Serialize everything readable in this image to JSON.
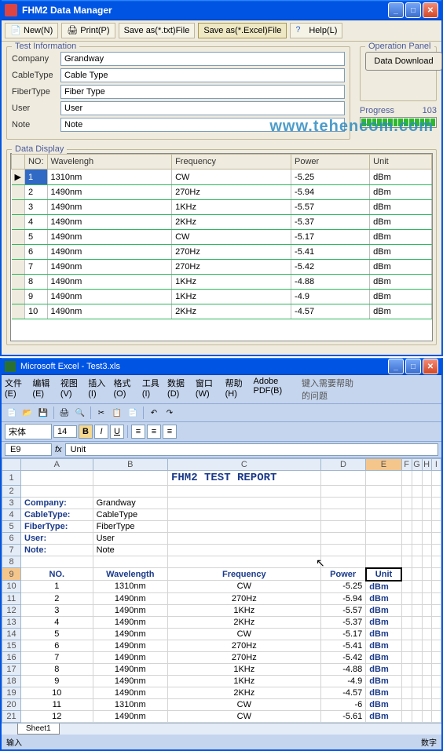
{
  "app1": {
    "title": "FHM2 Data Manager",
    "toolbar": [
      {
        "label": "New(N)"
      },
      {
        "label": "Print(P)"
      },
      {
        "label": "Save as(*.txt)File"
      },
      {
        "label": "Save as(*.Excel)File",
        "active": true
      },
      {
        "label": "Help(L)"
      }
    ],
    "test_info": {
      "title": "Test Information",
      "company_lbl": "Company",
      "company_val": "Grandway",
      "cabletype_lbl": "CableType",
      "cabletype_val": "Cable Type",
      "fibertype_lbl": "FiberType",
      "fibertype_val": "Fiber Type",
      "user_lbl": "User",
      "user_val": "User",
      "note_lbl": "Note",
      "note_val": "Note"
    },
    "op_panel": {
      "title": "Operation Panel",
      "download": "Data Download",
      "progress_lbl": "Progress",
      "progress_val": "103"
    },
    "data_display": {
      "title": "Data Display",
      "headers": [
        "",
        "NO:",
        "Wavelengh",
        "Frequency",
        "Power",
        "Unit"
      ],
      "rows": [
        [
          "1",
          "1310nm",
          "CW",
          "-5.25",
          "dBm"
        ],
        [
          "2",
          "1490nm",
          "270Hz",
          "-5.94",
          "dBm"
        ],
        [
          "3",
          "1490nm",
          "1KHz",
          "-5.57",
          "dBm"
        ],
        [
          "4",
          "1490nm",
          "2KHz",
          "-5.37",
          "dBm"
        ],
        [
          "5",
          "1490nm",
          "CW",
          "-5.17",
          "dBm"
        ],
        [
          "6",
          "1490nm",
          "270Hz",
          "-5.41",
          "dBm"
        ],
        [
          "7",
          "1490nm",
          "270Hz",
          "-5.42",
          "dBm"
        ],
        [
          "8",
          "1490nm",
          "1KHz",
          "-4.88",
          "dBm"
        ],
        [
          "9",
          "1490nm",
          "1KHz",
          "-4.9",
          "dBm"
        ],
        [
          "10",
          "1490nm",
          "2KHz",
          "-4.57",
          "dBm"
        ]
      ]
    },
    "watermark": "www.tehencom.com"
  },
  "app2": {
    "title": "Microsoft Excel - Test3.xls",
    "menus": [
      "文件(E)",
      "编辑(E)",
      "视图(V)",
      "插入(I)",
      "格式(O)",
      "工具(I)",
      "数据(D)",
      "窗口(W)",
      "帮助(H)",
      "Adobe PDF(B)"
    ],
    "help_hint": "键入需要帮助的问题",
    "font_name": "宋体",
    "font_size": "14",
    "namebox": "E9",
    "formula": "Unit",
    "col_headers": [
      "",
      "A",
      "B",
      "C",
      "D",
      "E",
      "F",
      "G",
      "H",
      "I"
    ],
    "report_title": "FHM2 TEST REPORT",
    "fields": {
      "company_lbl": "Company:",
      "company_val": "Grandway",
      "cabletype_lbl": "CableType:",
      "cabletype_val": "CableType",
      "fibertype_lbl": "FiberType:",
      "fibertype_val": "FiberType",
      "user_lbl": "User:",
      "user_val": "User",
      "note_lbl": "Note:",
      "note_val": "Note"
    },
    "tbl_headers": [
      "NO.",
      "Wavelength",
      "Frequency",
      "Power",
      "Unit"
    ],
    "tbl_rows": [
      [
        "1",
        "1310nm",
        "CW",
        "-5.25",
        "dBm"
      ],
      [
        "2",
        "1490nm",
        "270Hz",
        "-5.94",
        "dBm"
      ],
      [
        "3",
        "1490nm",
        "1KHz",
        "-5.57",
        "dBm"
      ],
      [
        "4",
        "1490nm",
        "2KHz",
        "-5.37",
        "dBm"
      ],
      [
        "5",
        "1490nm",
        "CW",
        "-5.17",
        "dBm"
      ],
      [
        "6",
        "1490nm",
        "270Hz",
        "-5.41",
        "dBm"
      ],
      [
        "7",
        "1490nm",
        "270Hz",
        "-5.42",
        "dBm"
      ],
      [
        "8",
        "1490nm",
        "1KHz",
        "-4.88",
        "dBm"
      ],
      [
        "9",
        "1490nm",
        "1KHz",
        "-4.9",
        "dBm"
      ],
      [
        "10",
        "1490nm",
        "2KHz",
        "-4.57",
        "dBm"
      ],
      [
        "11",
        "1310nm",
        "CW",
        "-6",
        "dBm"
      ],
      [
        "12",
        "1490nm",
        "CW",
        "-5.61",
        "dBm"
      ]
    ],
    "sheet_tab": "Sheet1",
    "status_left": "输入",
    "status_right": "数字"
  },
  "chart_data": {
    "type": "table",
    "title": "FHM2 TEST REPORT",
    "columns": [
      "NO.",
      "Wavelength",
      "Frequency",
      "Power",
      "Unit"
    ],
    "rows": [
      [
        1,
        "1310nm",
        "CW",
        -5.25,
        "dBm"
      ],
      [
        2,
        "1490nm",
        "270Hz",
        -5.94,
        "dBm"
      ],
      [
        3,
        "1490nm",
        "1KHz",
        -5.57,
        "dBm"
      ],
      [
        4,
        "1490nm",
        "2KHz",
        -5.37,
        "dBm"
      ],
      [
        5,
        "1490nm",
        "CW",
        -5.17,
        "dBm"
      ],
      [
        6,
        "1490nm",
        "270Hz",
        -5.41,
        "dBm"
      ],
      [
        7,
        "1490nm",
        "270Hz",
        -5.42,
        "dBm"
      ],
      [
        8,
        "1490nm",
        "1KHz",
        -4.88,
        "dBm"
      ],
      [
        9,
        "1490nm",
        "1KHz",
        -4.9,
        "dBm"
      ],
      [
        10,
        "1490nm",
        "2KHz",
        -4.57,
        "dBm"
      ],
      [
        11,
        "1310nm",
        "CW",
        -6,
        "dBm"
      ],
      [
        12,
        "1490nm",
        "CW",
        -5.61,
        "dBm"
      ]
    ]
  }
}
